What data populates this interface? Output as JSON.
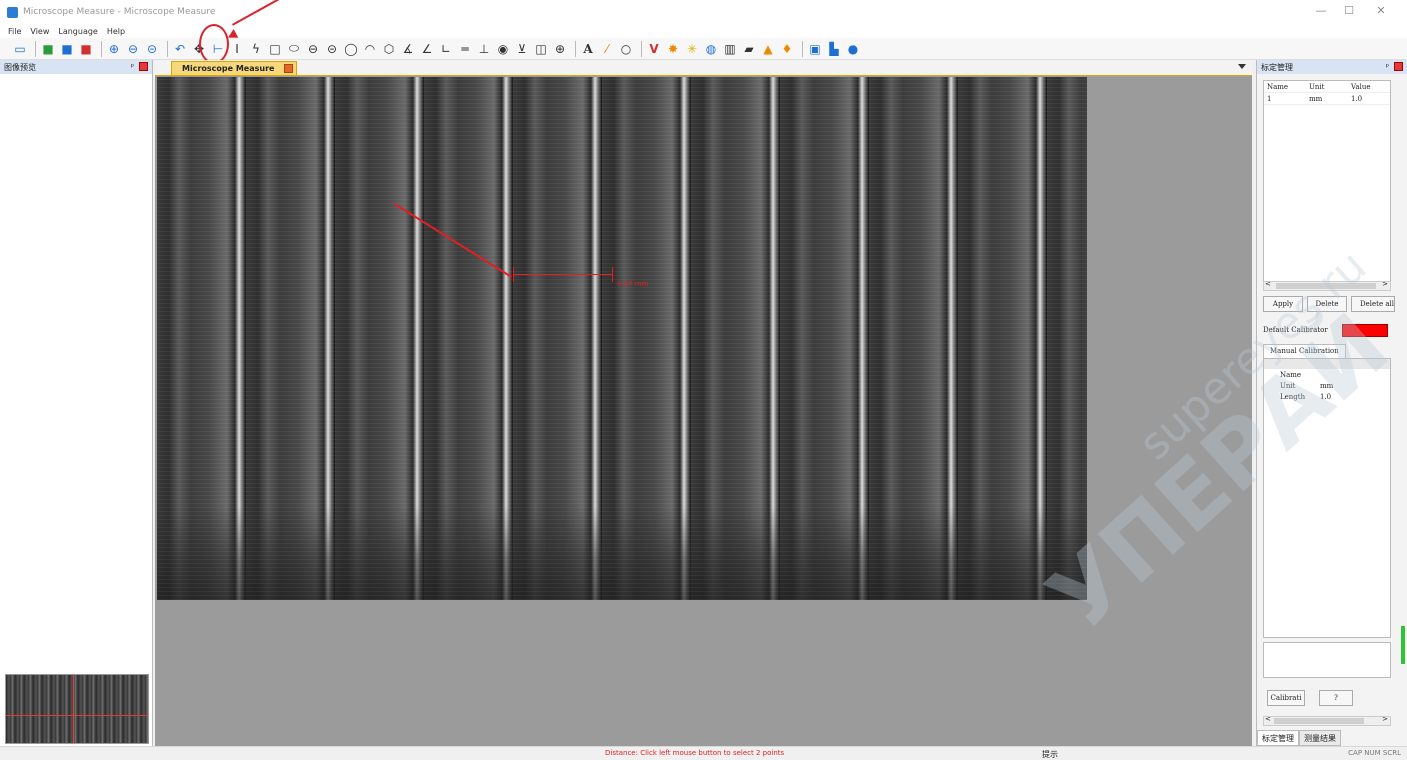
{
  "window": {
    "title": "Microscope Measure - Microscope Measure",
    "minimize": "—",
    "maximize": "☐",
    "close": "✕"
  },
  "menu": [
    "File",
    "View",
    "Language",
    "Help"
  ],
  "toolbar": [
    "monitor-icon",
    "green-doc-icon",
    "blue-doc-icon",
    "red-doc-icon",
    "zoom-in-icon",
    "zoom-out-icon",
    "zoom-fit-icon",
    "undo-icon",
    "pan-icon",
    "horizontal-distance-icon",
    "vertical-distance-icon",
    "polyline-icon",
    "rectangle-icon",
    "ellipse-icon",
    "circle-3pt-icon",
    "circle-center-icon",
    "circle-icon",
    "arc-icon",
    "polygon-icon",
    "angle-icon",
    "angle2-icon",
    "parallel-icon",
    "perpendicular-icon",
    "point-icon",
    "text-icon",
    "grid-icon",
    "scale-icon",
    "letter-a-icon",
    "edit-icon",
    "circle-outline-icon",
    "v-icon",
    "sun-icon",
    "star-icon",
    "color-wheel-icon",
    "film-icon",
    "camera-icon",
    "cone-icon",
    "fire-icon",
    "screen-capture-icon",
    "plugin-icon",
    "help-icon"
  ],
  "left_panel": {
    "title": "图像预览",
    "pin": "ᵖ"
  },
  "document": {
    "tab_label": "Microscope Measure",
    "measure_label": "0.47 mm"
  },
  "right_panel": {
    "title": "标定管理",
    "pin": "ᵖ",
    "grid": {
      "columns": [
        "Name",
        "Unit",
        "Value"
      ],
      "rows": [
        [
          "1",
          "mm",
          "1.0"
        ]
      ]
    },
    "scroll_left": "<",
    "scroll_right": ">",
    "buttons": {
      "apply": "Apply",
      "delete": "Delete",
      "delete_all": "Delete all"
    },
    "default_label": "Default Calibrator",
    "tab": "Manual Calibration",
    "props": [
      [
        "Name",
        ""
      ],
      [
        "Unit",
        "mm"
      ],
      [
        "Length",
        "1.0"
      ]
    ],
    "calib_button": "Calibrati",
    "help_button": "?",
    "bottom_tabs": [
      "标定管理",
      "测量结果"
    ]
  },
  "status": {
    "message": "Distance: Click left mouse button to select 2 points",
    "hint": "提示",
    "keys": "CAP NUM SCRL"
  },
  "watermark": {
    "line1": "УПЕРАЙ",
    "line2": "supereyes.ru"
  },
  "colors": {
    "accent": "#d9232d",
    "calibrator": "#ff0000",
    "tab": "#f6d77a"
  }
}
